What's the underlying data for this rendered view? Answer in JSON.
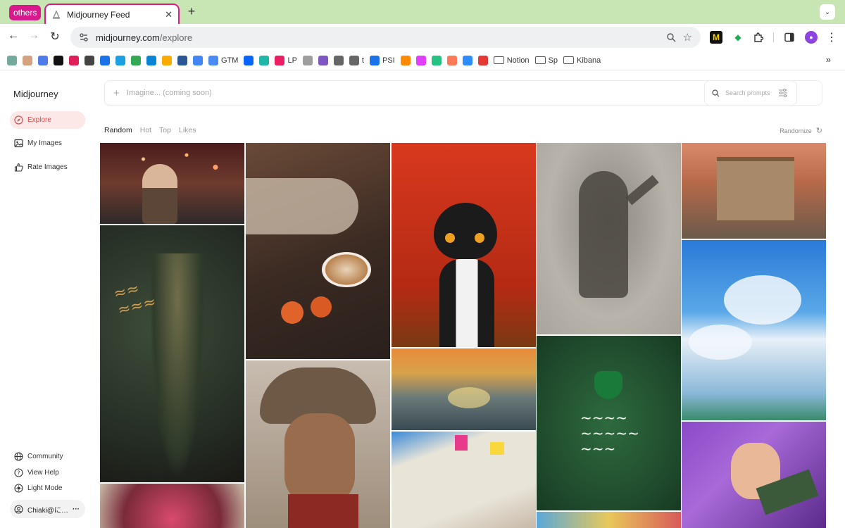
{
  "browser": {
    "tab_group": "others",
    "tab_title": "Midjourney Feed",
    "url_host": "midjourney.com",
    "url_path": "/explore",
    "bookmarks": [
      {
        "label": "",
        "icon": "chatgpt-icon",
        "color": "#74aa9c"
      },
      {
        "label": "",
        "icon": "anthropic-icon",
        "color": "#d4a27f"
      },
      {
        "label": "",
        "icon": "gemini-icon",
        "color": "#4f7ce8"
      },
      {
        "label": "",
        "icon": "midjourney-icon",
        "color": "#111111"
      },
      {
        "label": "",
        "icon": "slack-icon",
        "color": "#e01e5a"
      },
      {
        "label": "",
        "icon": "linear-icon",
        "color": "#444444"
      },
      {
        "label": "",
        "icon": "calendar-icon",
        "color": "#1a73e8"
      },
      {
        "label": "",
        "icon": "c-icon",
        "color": "#1ba1e2"
      },
      {
        "label": "",
        "icon": "drive-icon",
        "color": "#34a853"
      },
      {
        "label": "",
        "icon": "cloud-icon",
        "color": "#0a84d6"
      },
      {
        "label": "",
        "icon": "analytics-icon",
        "color": "#f9ab00"
      },
      {
        "label": "",
        "icon": "triangle-icon",
        "color": "#2b5797"
      },
      {
        "label": "",
        "icon": "ads-icon",
        "color": "#4285f4"
      },
      {
        "label": "GTM",
        "icon": "gtm-icon",
        "color": "#4a8af4"
      },
      {
        "label": "",
        "icon": "meta-icon",
        "color": "#0866ff"
      },
      {
        "label": "",
        "icon": "dots-icon",
        "color": "#21b6a8"
      },
      {
        "label": "LP",
        "icon": "gift-icon",
        "color": "#e91e63"
      },
      {
        "label": "",
        "icon": "circle-icon",
        "color": "#9e9e9e"
      },
      {
        "label": "",
        "icon": "puzzle-icon",
        "color": "#7e57c2"
      },
      {
        "label": "",
        "icon": "globe-icon",
        "color": "#666666"
      },
      {
        "label": "t",
        "icon": "globe-icon",
        "color": "#666666"
      },
      {
        "label": "PSI",
        "icon": "speed-icon",
        "color": "#1a73e8"
      },
      {
        "label": "",
        "icon": "chart-icon",
        "color": "#ff8a00"
      },
      {
        "label": "",
        "icon": "pen-icon",
        "color": "#e040fb"
      },
      {
        "label": "",
        "icon": "b-icon",
        "color": "#26c281"
      },
      {
        "label": "",
        "icon": "hubspot-icon",
        "color": "#ff7a59"
      },
      {
        "label": "",
        "icon": "zm-icon",
        "color": "#2d8cff"
      },
      {
        "label": "",
        "icon": "flower-icon",
        "color": "#e53935"
      },
      {
        "label": "Notion",
        "icon": "folder-icon",
        "color": ""
      },
      {
        "label": "Sp",
        "icon": "folder-icon",
        "color": ""
      },
      {
        "label": "Kibana",
        "icon": "folder-icon",
        "color": ""
      }
    ],
    "overflow": "»"
  },
  "sidebar": {
    "brand": "Midjourney",
    "nav": [
      {
        "label": "Explore",
        "icon": "compass-icon",
        "active": true
      },
      {
        "label": "My Images",
        "icon": "image-icon",
        "active": false
      },
      {
        "label": "Rate Images",
        "icon": "thumbs-up-icon",
        "active": false
      }
    ],
    "footer": [
      {
        "label": "Community",
        "icon": "globe-icon"
      },
      {
        "label": "View Help",
        "icon": "help-icon"
      },
      {
        "label": "Light Mode",
        "icon": "sun-icon"
      }
    ],
    "user": "Chiaki@に…",
    "user_more": "···"
  },
  "main": {
    "imagine_placeholder": "Imagine... (coming soon)",
    "search_placeholder": "Search prompts",
    "sort_tabs": [
      "Random",
      "Hot",
      "Top",
      "Likes"
    ],
    "active_sort": "Random",
    "randomize_label": "Randomize"
  },
  "colors": {
    "accent": "#e0484a",
    "tab_group": "#d81b8c",
    "tabstrip": "#c8e6b4"
  }
}
